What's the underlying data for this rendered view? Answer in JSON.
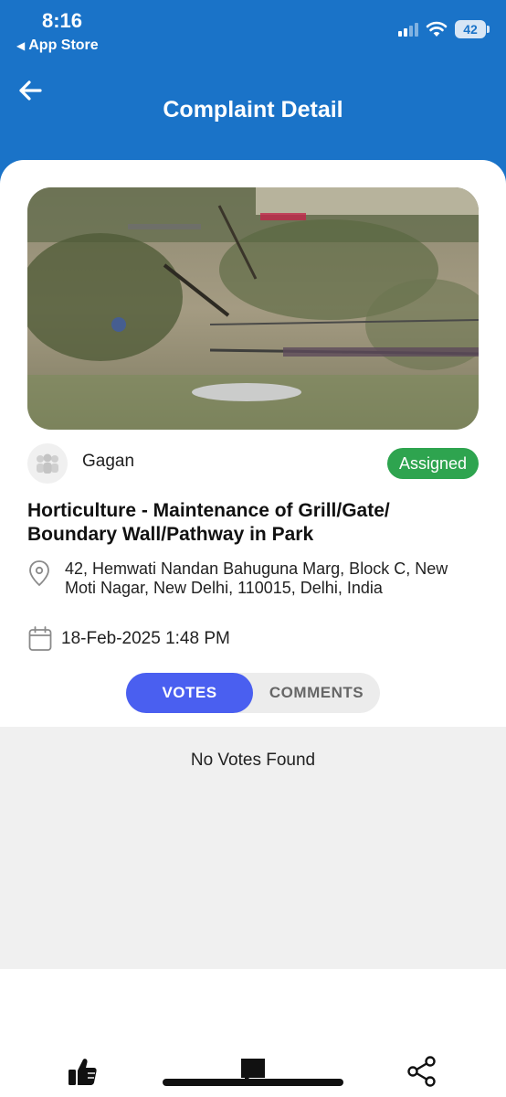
{
  "status_bar": {
    "time": "8:16",
    "back_app": "App Store",
    "battery": "42"
  },
  "header": {
    "title": "Complaint Detail",
    "background_color": "#1a73c8"
  },
  "complaint": {
    "username": "Gagan",
    "status": "Assigned",
    "status_color": "#2ea44f",
    "title": "Horticulture - Maintenance of Grill/Gate/ Boundary Wall/Pathway in Park",
    "address": "42, Hemwati Nandan Bahuguna Marg, Block C, New Moti Nagar, New Delhi, 110015, Delhi, India",
    "date": "18-Feb-2025 1:48 PM"
  },
  "tabs": [
    {
      "label": "VOTES",
      "selected": true
    },
    {
      "label": "COMMENTS",
      "selected": false
    }
  ],
  "votes": {
    "empty_message": "No Votes Found"
  },
  "bottom_bar": {
    "icons": [
      "thumbs-up-icon",
      "comment-icon",
      "share-icon"
    ]
  },
  "colors": {
    "accent": "#4a5ff0",
    "panel": "#f0f0f0"
  }
}
